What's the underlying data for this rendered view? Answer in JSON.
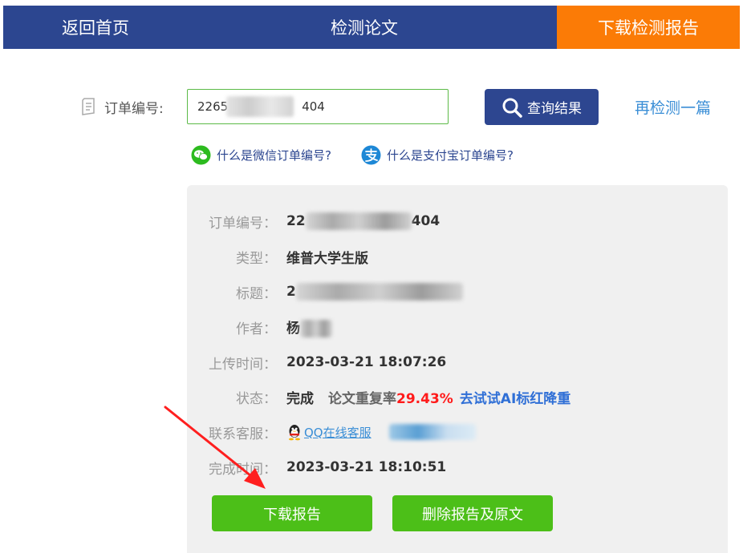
{
  "nav": {
    "home": "返回首页",
    "check": "检测论文",
    "download": "下载检测报告"
  },
  "query": {
    "order_label": "订单编号:",
    "order_prefix": "2265",
    "order_suffix": "404",
    "button": "查询结果",
    "recheck": "再检测一篇"
  },
  "help": {
    "wechat": "什么是微信订单编号?",
    "alipay": "什么是支付宝订单编号?"
  },
  "info": {
    "order_label": "订单编号：",
    "order_prefix": "22",
    "order_suffix": "404",
    "type_label": "类型：",
    "type_value": "维普大学生版",
    "title_label": "标题：",
    "title_prefix": "2",
    "author_label": "作者：",
    "author_prefix": "杨",
    "upload_label": "上传时间：",
    "upload_value": "2023-03-21 18:07:26",
    "status_label": "状态：",
    "status_value": "完成",
    "dup_label": "论文重复率",
    "dup_value": "29.43%",
    "ai_link": "去试试AI标红降重",
    "service_label": "联系客服：",
    "qq_link": "QQ在线客服",
    "finish_label": "完成时间：",
    "finish_value": "2023-03-21 18:10:51"
  },
  "buttons": {
    "download": "下载报告",
    "delete": "删除报告及原文"
  },
  "colors": {
    "nav_bg": "#2c4690",
    "nav_active": "#fb7b06",
    "button_green": "#4cbf18",
    "dup_red": "#ff1a1a",
    "link_blue": "#3a8ed6"
  }
}
